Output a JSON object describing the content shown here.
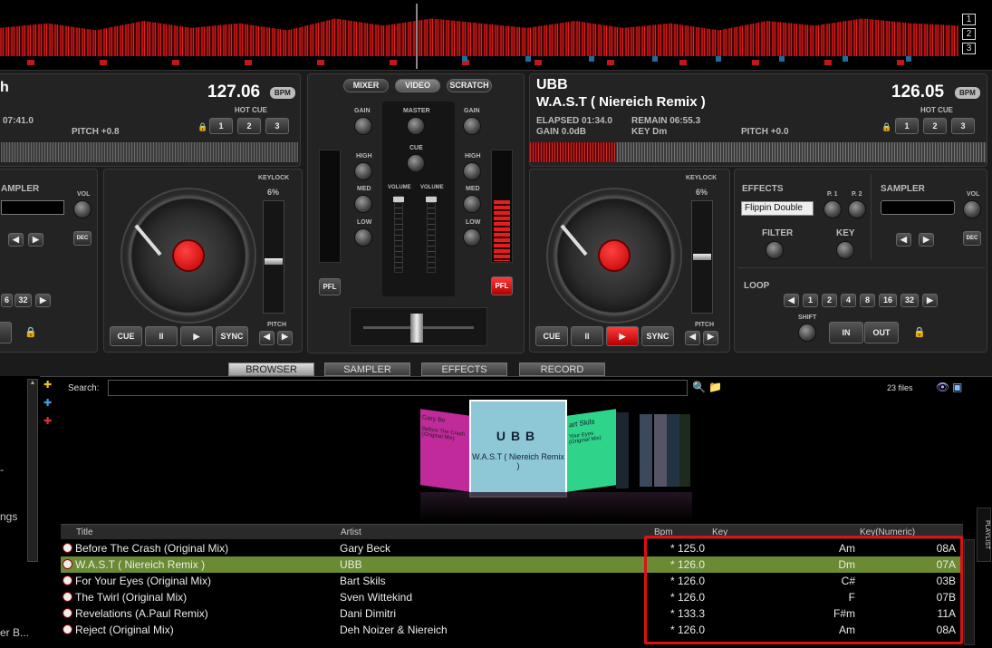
{
  "deck_numbers": [
    "1",
    "2",
    "3"
  ],
  "left_deck": {
    "title_fragment": "h",
    "time_fragment": "07:41.0",
    "pitch": "PITCH +0.8",
    "bpm": "127.06",
    "bpm_tag": "BPM",
    "hot_cue_label": "HOT CUE",
    "hot_cues": [
      "1",
      "2",
      "3"
    ],
    "sampler_label": "AMPLER",
    "vol_label": "VOL",
    "dec_label": "DEC",
    "keylock_label": "KEYLOCK",
    "pitch_pct": "6%",
    "loop_btns": [
      "6",
      "32"
    ],
    "transport": {
      "cue": "CUE",
      "pause": "II",
      "play": "▶",
      "sync": "SYNC"
    },
    "pitch_label": "PITCH"
  },
  "mixer": {
    "tabs": [
      "MIXER",
      "VIDEO",
      "SCRATCH"
    ],
    "gain": "GAIN",
    "master": "MASTER",
    "cue": "CUE",
    "high": "HIGH",
    "med": "MED",
    "low": "LOW",
    "volume": "VOLUME",
    "pfl": "PFL"
  },
  "right_deck": {
    "artist": "UBB",
    "title": "W.A.S.T ( Niereich Remix )",
    "elapsed": "ELAPSED 01:34.0",
    "remain": "REMAIN 06:55.3",
    "gain": "GAIN 0.0dB",
    "key": "KEY Dm",
    "pitch": "PITCH +0.0",
    "bpm": "126.05",
    "bpm_tag": "BPM",
    "hot_cue_label": "HOT CUE",
    "hot_cues": [
      "1",
      "2",
      "3"
    ],
    "keylock_label": "KEYLOCK",
    "pitch_pct": "6%",
    "effects_label": "EFFECTS",
    "effect_selected": "Flippin Double",
    "p1": "P. 1",
    "p2": "P. 2",
    "filter": "FILTER",
    "key_label": "KEY",
    "sampler_label": "SAMPLER",
    "vol_label": "VOL",
    "dec_label": "DEC",
    "loop_label": "LOOP",
    "loop_btns": [
      "◀",
      "1",
      "2",
      "4",
      "8",
      "16",
      "32",
      "▶"
    ],
    "shift_label": "SHIFT",
    "in_label": "IN",
    "out_label": "OUT",
    "transport": {
      "cue": "CUE",
      "pause": "II",
      "play": "▶",
      "sync": "SYNC"
    },
    "pitch_label": "PITCH"
  },
  "bottom_tabs": [
    "BROWSER",
    "SAMPLER",
    "EFFECTS",
    "RECORD"
  ],
  "sidebar_fragments": [
    "ngs",
    "er B..."
  ],
  "search": {
    "label": "Search:",
    "value": "",
    "files": "23 files"
  },
  "side_tab": "PLAYLIST",
  "covers": [
    {
      "line1": "Gary Be",
      "line2": "Before The Crash (Original Mix)",
      "color": "#c02a9a"
    },
    {
      "line1": "UBB",
      "line2": "W.A.S.T ( Niereich Remix )",
      "color": "#8ec7d6"
    },
    {
      "line1": "art Skils",
      "line2": "Your Eyes (Original Mix)",
      "color": "#2ed48a"
    }
  ],
  "columns": [
    "Title",
    "Artist",
    "Bpm",
    "Key",
    "Key(Numeric)"
  ],
  "tracks": [
    {
      "title": "Before The Crash (Original Mix)",
      "artist": "Gary Beck",
      "bpm": "* 125.0",
      "key": "Am",
      "keynum": "08A"
    },
    {
      "title": "W.A.S.T ( Niereich Remix )",
      "artist": "UBB",
      "bpm": "* 126.0",
      "key": "Dm",
      "keynum": "07A"
    },
    {
      "title": "For Your Eyes (Original Mix)",
      "artist": "Bart Skils",
      "bpm": "* 126.0",
      "key": "C#",
      "keynum": "03B"
    },
    {
      "title": "The Twirl (Original Mix)",
      "artist": "Sven Wittekind",
      "bpm": "* 126.0",
      "key": "F",
      "keynum": "07B"
    },
    {
      "title": "Revelations (A.Paul Remix)",
      "artist": "Dani Dimitri",
      "bpm": "* 133.3",
      "key": "F#m",
      "keynum": "11A"
    },
    {
      "title": "Reject (Original Mix)",
      "artist": "Deh Noizer & Niereich",
      "bpm": "* 126.0",
      "key": "Am",
      "keynum": "08A"
    }
  ],
  "selected_index": 1,
  "highlight_color": "#e01010",
  "accent_red": "#e02020",
  "selection_color": "#6a8a34"
}
